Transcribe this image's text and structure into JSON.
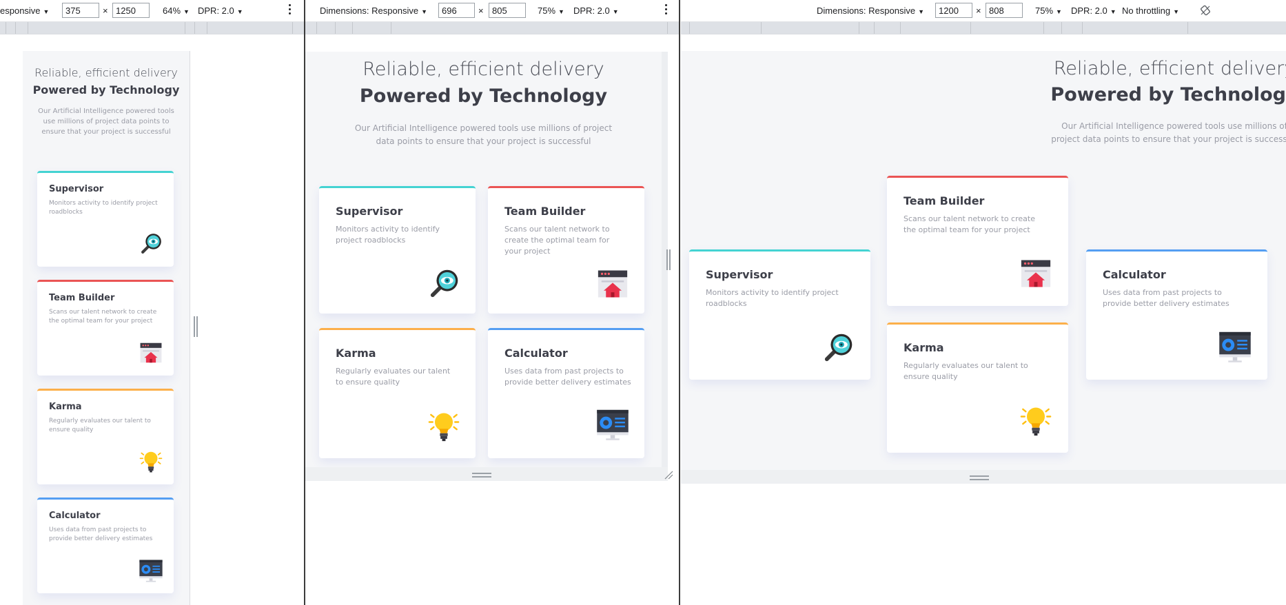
{
  "devtools": {
    "panes": [
      {
        "device_label": "esponsive",
        "width": "375",
        "height": "1250",
        "zoom": "64%",
        "dpr": "DPR: 2.0"
      },
      {
        "device_label": "Dimensions: Responsive",
        "width": "696",
        "height": "805",
        "zoom": "75%",
        "dpr": "DPR: 2.0"
      },
      {
        "device_label": "Dimensions: Responsive",
        "width": "1200",
        "height": "808",
        "zoom": "75%",
        "dpr": "DPR: 2.0",
        "throttling": "No throttling"
      }
    ],
    "times_sign": "×",
    "more_icon": "kebab-icon",
    "rotate_icon": "rotate-icon",
    "caret_icon": "caret-down-icon"
  },
  "page": {
    "heading_light": "Reliable, efficient delivery",
    "heading_bold": "Powered by Technology",
    "intro": "Our Artificial Intelligence powered tools use millions of project data points to ensure that your project is successful",
    "cards": [
      {
        "title": "Supervisor",
        "description": "Monitors activity to identify project roadblocks",
        "icon": "magnifier-eye-icon",
        "accent": "#44d3d2"
      },
      {
        "title": "Team Builder",
        "description": "Scans our talent network to create the optimal team for your project",
        "icon": "team-builder-house-icon",
        "accent": "#ea5454"
      },
      {
        "title": "Karma",
        "description": "Regularly evaluates our talent to ensure quality",
        "icon": "lightbulb-icon",
        "accent": "#fcaf4a"
      },
      {
        "title": "Calculator",
        "description": "Uses data from past projects to provide better delivery estimates",
        "icon": "calculator-monitor-icon",
        "accent": "#549ef2"
      }
    ]
  }
}
